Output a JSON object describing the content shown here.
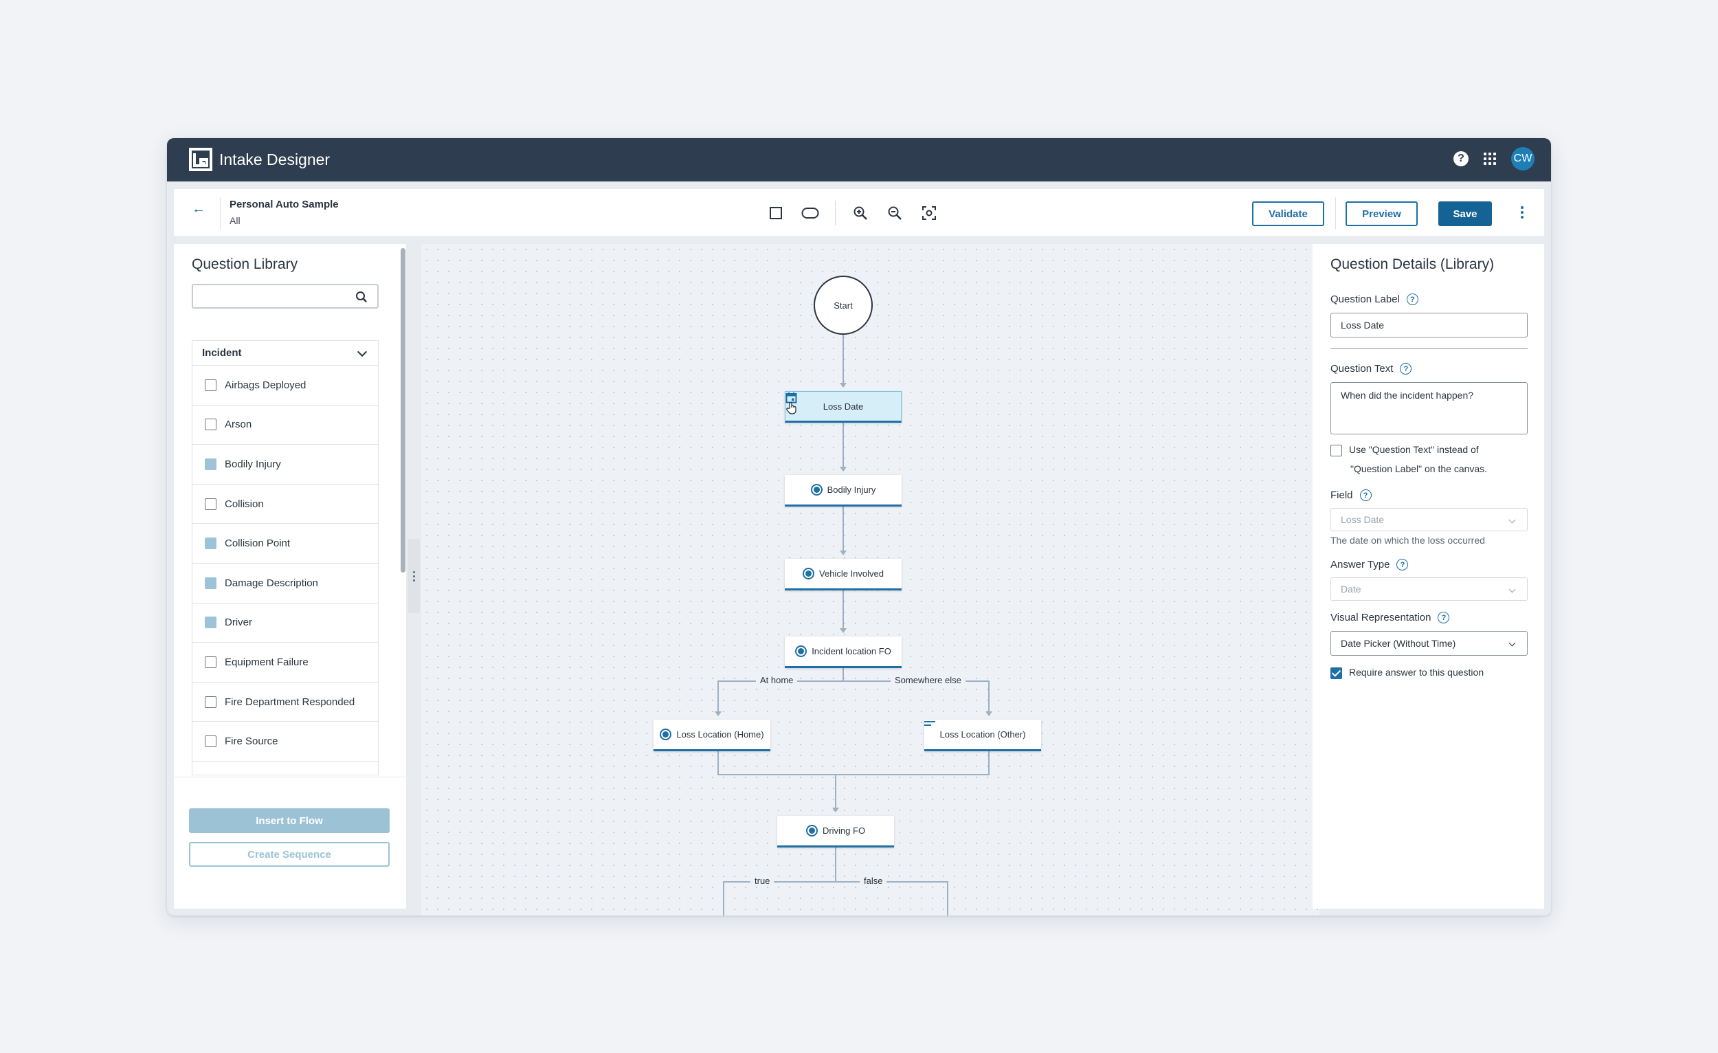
{
  "app": {
    "title": "Intake Designer",
    "avatar_initials": "CW"
  },
  "toolbar": {
    "doc_title": "Personal Auto Sample",
    "doc_subtitle": "All",
    "validate_label": "Validate",
    "preview_label": "Preview",
    "save_label": "Save"
  },
  "library": {
    "title": "Question Library",
    "category": "Incident",
    "items": [
      {
        "label": "Airbags Deployed",
        "checked": false
      },
      {
        "label": "Arson",
        "checked": false
      },
      {
        "label": "Bodily Injury",
        "checked": true
      },
      {
        "label": "Collision",
        "checked": false
      },
      {
        "label": "Collision Point",
        "checked": true
      },
      {
        "label": "Damage Description",
        "checked": true
      },
      {
        "label": "Driver",
        "checked": true
      },
      {
        "label": "Equipment Failure",
        "checked": false
      },
      {
        "label": "Fire Department Responded",
        "checked": false
      },
      {
        "label": "Fire Source",
        "checked": false
      }
    ],
    "insert_label": "Insert to Flow",
    "create_label": "Create Sequence"
  },
  "canvas": {
    "start_label": "Start",
    "nodes": {
      "loss_date": "Loss Date",
      "bodily_injury": "Bodily Injury",
      "vehicle_involved": "Vehicle Involved",
      "incident_location": "Incident location FO",
      "loss_home": "Loss Location (Home)",
      "loss_other": "Loss Location (Other)",
      "driving_fo": "Driving FO"
    },
    "edges": {
      "at_home": "At home",
      "somewhere_else": "Somewhere else",
      "true": "true",
      "false": "false"
    }
  },
  "details": {
    "title": "Question Details (Library)",
    "question_label_label": "Question Label",
    "question_label_value": "Loss Date",
    "question_text_label": "Question Text",
    "question_text_value": "When did the incident happen?",
    "use_text_line1": "Use \"Question Text\" instead of",
    "use_text_line2": "\"Question Label\" on the canvas.",
    "field_label": "Field",
    "field_value": "Loss Date",
    "field_help": "The date on which the loss occurred",
    "answer_type_label": "Answer Type",
    "answer_type_value": "Date",
    "visual_rep_label": "Visual Representation",
    "visual_rep_value": "Date Picker (Without Time)",
    "require_label": "Require answer to this question"
  }
}
